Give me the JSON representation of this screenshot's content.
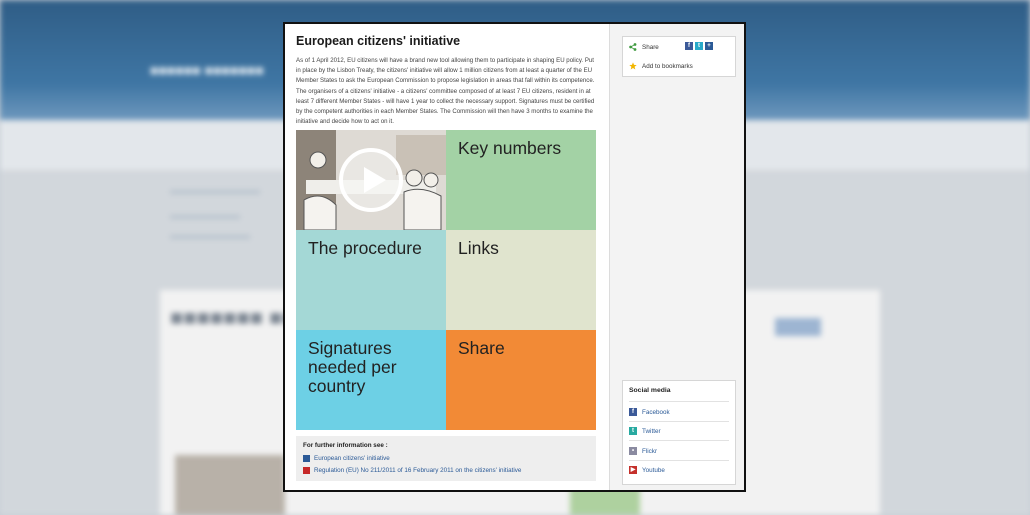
{
  "modal": {
    "title": "European citizens' initiative",
    "intro": "As of 1 April 2012, EU citizens will have a brand new tool allowing them to participate in shaping EU policy. Put in place by the Lisbon Treaty, the citizens' initiative will allow 1 million citizens from at least a quarter of the EU Member States to ask the European Commission to propose legislation in areas that fall within its competence. The organisers of a citizens' initiative - a citizens' committee composed of at least 7 EU citizens, resident in at least 7 different Member States - will have 1 year to collect the necessary support. Signatures must be certified by the competent authorities in each Member States. The Commission will then have 3 months to examine the initiative and decide how to act on it.",
    "tiles": {
      "key_numbers": "Key numbers",
      "procedure": "The procedure",
      "links": "Links",
      "signatures": "Signatures needed per country",
      "share": "Share"
    },
    "further": {
      "heading": "For further information see :",
      "links": [
        "European citizens' initiative",
        "Regulation (EU) No 211/2011 of 16 February 2011 on the citizens' initiative"
      ]
    }
  },
  "sidebar": {
    "share_label": "Share",
    "bookmark_label": "Add to bookmarks",
    "social": {
      "heading": "Social media",
      "items": [
        "Facebook",
        "Twitter",
        "Flickr",
        "Youtube"
      ]
    }
  },
  "colors": {
    "key_numbers": "#a3d2a5",
    "procedure": "#a4d8d6",
    "links": "#e0e4ce",
    "signatures": "#6dd0e5",
    "share": "#f28a36"
  },
  "icons": {
    "share": "share-icon",
    "bookmark": "star-icon",
    "video": "play-icon",
    "facebook": "facebook-icon",
    "twitter": "twitter-icon",
    "flickr": "flickr-icon",
    "youtube": "youtube-icon"
  }
}
